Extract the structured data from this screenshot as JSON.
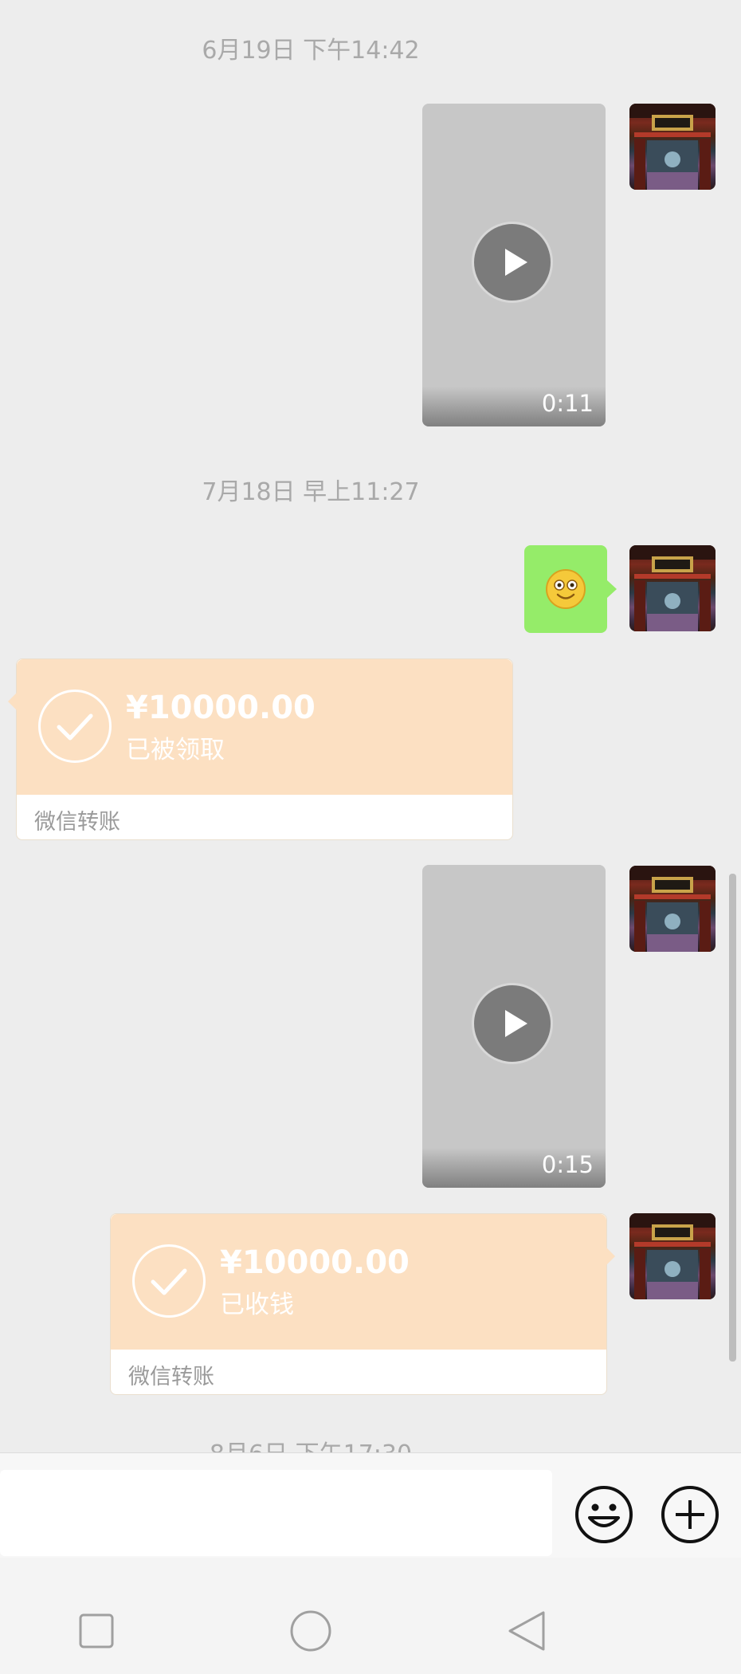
{
  "messages": {
    "timestamp_1": "6月19日 下午14:42",
    "video_1_duration": "0:11",
    "timestamp_2": "7月18日 早上11:27",
    "transfer_1": {
      "amount": "¥10000.00",
      "status": "已被领取",
      "label": "微信转账"
    },
    "video_2_duration": "0:15",
    "transfer_2": {
      "amount": "¥10000.00",
      "status": "已收钱",
      "label": "微信转账"
    },
    "timestamp_3_partial": "8月6日 下午17:30"
  },
  "colors": {
    "background": "#ededed",
    "sent_bubble": "#95ec69",
    "transfer_card": "#fce0c2",
    "timestamp_text": "#a9a9a9"
  },
  "icons": {
    "emoji_button": "smiley-face-icon",
    "more_button": "plus-circle-icon",
    "nav_recent": "square-icon",
    "nav_home": "circle-icon",
    "nav_back": "triangle-back-icon"
  }
}
